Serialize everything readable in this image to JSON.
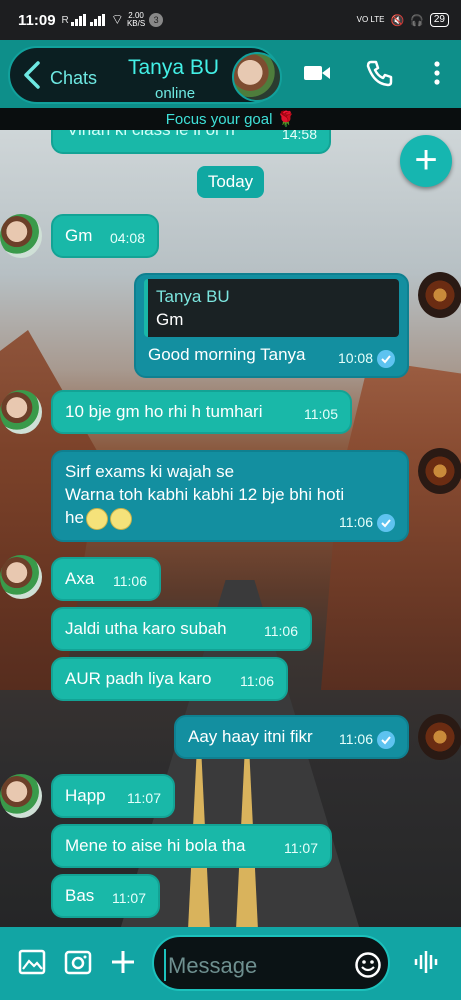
{
  "status_bar": {
    "time": "11:09",
    "network_speed_value": "2.00",
    "network_speed_unit": "KB/S",
    "notification_count": "3",
    "volte": "VO LTE",
    "battery": "29"
  },
  "header": {
    "back_label": "Chats",
    "contact_name": "Tanya BU",
    "contact_status": "online"
  },
  "motto": "Focus your goal 🌹",
  "date_chip": "Today",
  "messages": [
    {
      "id": "m0",
      "text": "Vihan ki class le li or h",
      "time": "14:58",
      "dir": "in"
    },
    {
      "id": "m1",
      "text": "Gm",
      "time": "04:08",
      "dir": "in"
    },
    {
      "id": "m2",
      "reply_name": "Tanya BU",
      "reply_text": "Gm",
      "text": "Good morning Tanya",
      "time": "10:08",
      "dir": "out"
    },
    {
      "id": "m3",
      "text": "10 bje gm ho rhi h tumhari",
      "time": "11:05",
      "dir": "in"
    },
    {
      "id": "m4",
      "line1": "Sirf exams ki wajah se",
      "line2": "Warna toh kabhi kabhi 12 bje bhi hoti",
      "line3": "he",
      "time": "11:06",
      "dir": "out"
    },
    {
      "id": "m5",
      "text": "Axa",
      "time": "11:06",
      "dir": "in"
    },
    {
      "id": "m6",
      "text": "Jaldi utha karo subah",
      "time": "11:06",
      "dir": "in"
    },
    {
      "id": "m7",
      "text": "AUR padh liya karo",
      "time": "11:06",
      "dir": "in"
    },
    {
      "id": "m8",
      "text": "Aay haay itni fikr",
      "time": "11:06",
      "dir": "out"
    },
    {
      "id": "m9",
      "text": "Happ",
      "time": "11:07",
      "dir": "in"
    },
    {
      "id": "m10",
      "text": "Mene to aise hi bola tha",
      "time": "11:07",
      "dir": "in"
    },
    {
      "id": "m11",
      "text": "Bas",
      "time": "11:07",
      "dir": "in"
    }
  ],
  "composer": {
    "placeholder": "Message"
  },
  "colors": {
    "accent": "#12a5a4",
    "incoming_bubble": "#19b8a8",
    "outgoing_bubble": "#138fa0",
    "read_tick": "#5ec3f0"
  },
  "icons": [
    "back-arrow-icon",
    "video-call-icon",
    "phone-icon",
    "more-vert-icon",
    "add-icon",
    "gallery-icon",
    "camera-icon",
    "plus-icon",
    "emoji-icon",
    "voice-icon",
    "read-tick-icon"
  ]
}
